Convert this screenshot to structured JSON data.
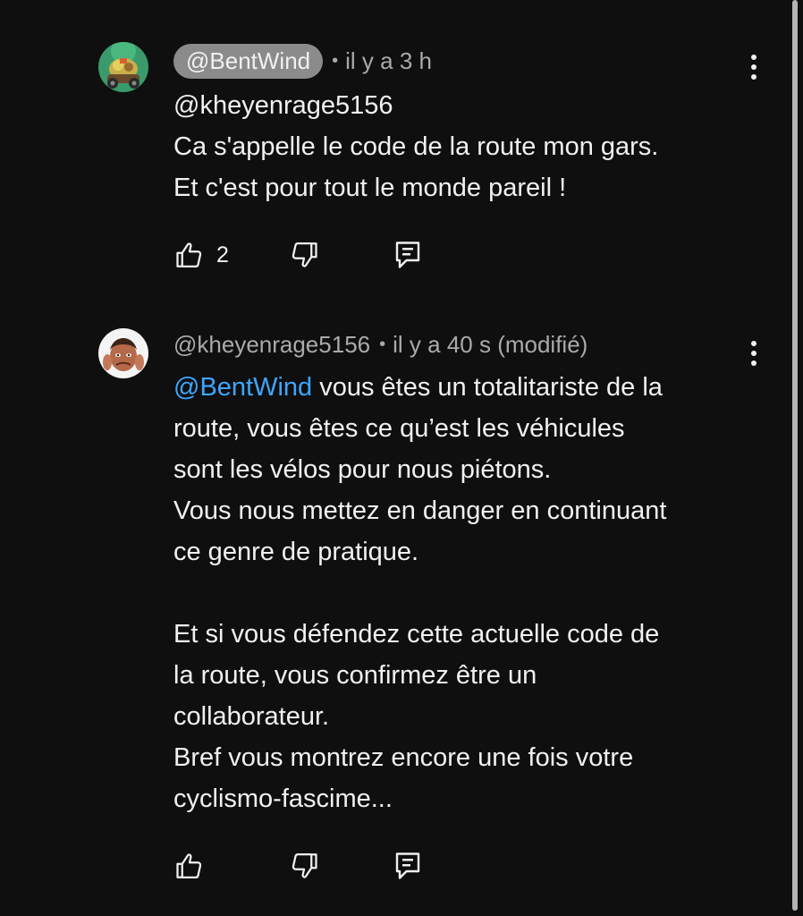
{
  "comments": [
    {
      "author": "@BentWind",
      "time": "il y a 3 h",
      "lines": [
        "@kheyenrage5156",
        "Ca s'appelle le code de la route mon gars.",
        "Et c'est pour tout le monde pareil !"
      ],
      "likes": "2",
      "avatar": "avatar-bentwind"
    },
    {
      "author": "@kheyenrage5156",
      "time": "il y a 40 s (modifié)",
      "mention": "@BentWind",
      "first_line_rest": " vous êtes un totalitariste de la",
      "lines": [
        "route, vous êtes ce qu’est les véhicules",
        "sont les vélos pour nous piétons.",
        "Vous nous mettez en danger en continuant",
        "ce genre de pratique.",
        "",
        "Et si vous défendez cette actuelle code de",
        "la route, vous confirmez être un",
        "collaborateur.",
        "Bref vous montrez encore une fois votre",
        "cyclismo-fascime..."
      ],
      "avatar": "avatar-kheyenrage"
    }
  ],
  "separator": "•",
  "colors": {
    "background": "#0f0f0f",
    "text": "#f1f1f1",
    "secondary": "#aaaaaa",
    "mention": "#3ea6ff",
    "author_pill": "#8b8b8b"
  },
  "icons": [
    "thumbs-up-icon",
    "thumbs-down-icon",
    "reply-icon",
    "more-vert-icon"
  ]
}
